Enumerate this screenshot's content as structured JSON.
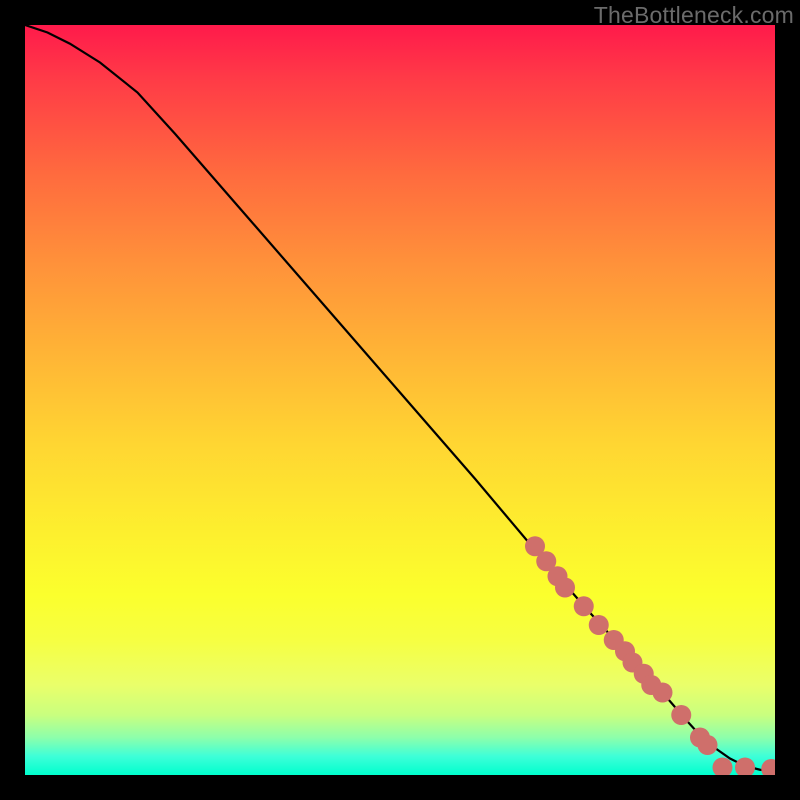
{
  "watermark": "TheBottleneck.com",
  "chart_data": {
    "type": "line",
    "title": "",
    "xlabel": "",
    "ylabel": "",
    "xlim": [
      0,
      100
    ],
    "ylim": [
      0,
      100
    ],
    "grid": false,
    "legend": false,
    "curve": {
      "name": "performance-curve",
      "color": "#000000",
      "x": [
        0,
        3,
        6,
        10,
        15,
        20,
        30,
        40,
        50,
        60,
        68,
        75,
        80,
        85,
        88,
        90,
        92,
        94,
        96,
        98,
        100
      ],
      "y": [
        100,
        99,
        97.5,
        95,
        91,
        85.5,
        74,
        62.5,
        51,
        39.5,
        30,
        22,
        16.5,
        11,
        7.5,
        5.3,
        3.6,
        2.2,
        1.2,
        0.7,
        0.5
      ]
    },
    "markers": {
      "name": "data-points",
      "color": "#cf6f6b",
      "radius": 10,
      "points": [
        {
          "x": 68,
          "y": 30.5
        },
        {
          "x": 69.5,
          "y": 28.5
        },
        {
          "x": 71,
          "y": 26.5
        },
        {
          "x": 72,
          "y": 25
        },
        {
          "x": 74.5,
          "y": 22.5
        },
        {
          "x": 76.5,
          "y": 20
        },
        {
          "x": 78.5,
          "y": 18
        },
        {
          "x": 80,
          "y": 16.5
        },
        {
          "x": 81,
          "y": 15
        },
        {
          "x": 82.5,
          "y": 13.5
        },
        {
          "x": 83.5,
          "y": 12
        },
        {
          "x": 85,
          "y": 11
        },
        {
          "x": 87.5,
          "y": 8
        },
        {
          "x": 90,
          "y": 5
        },
        {
          "x": 91,
          "y": 4
        },
        {
          "x": 93,
          "y": 1
        },
        {
          "x": 96,
          "y": 1
        },
        {
          "x": 99.5,
          "y": 0.8
        }
      ]
    }
  }
}
